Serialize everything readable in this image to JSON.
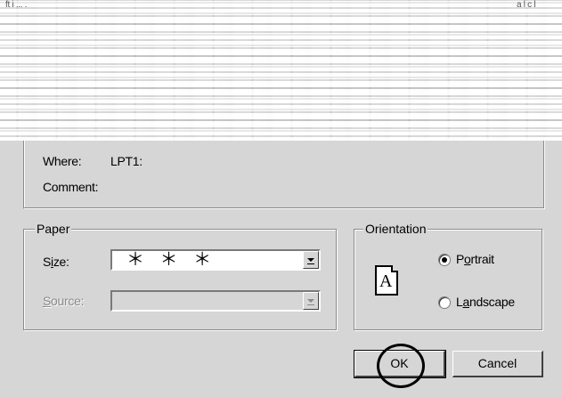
{
  "header_fragments": {
    "left": "ft i ... .",
    "right": "a l c l"
  },
  "printer": {
    "where_label": "Where:",
    "where_value": "LPT1:",
    "comment_label": "Comment:",
    "comment_value": ""
  },
  "paper": {
    "group_label": "Paper",
    "size_label": "Size:",
    "size_value": "＊ ＊ ＊",
    "source_label": "Source:",
    "source_value": ""
  },
  "orientation": {
    "group_label": "Orientation",
    "preview_glyph": "A",
    "portrait_label": "Portrait",
    "landscape_label": "Landscape",
    "selected": "portrait"
  },
  "buttons": {
    "ok": "OK",
    "cancel": "Cancel"
  },
  "colors": {
    "face": "#d6d6d6",
    "shadow": "#8a8a8a",
    "highlight": "#ffffff"
  }
}
